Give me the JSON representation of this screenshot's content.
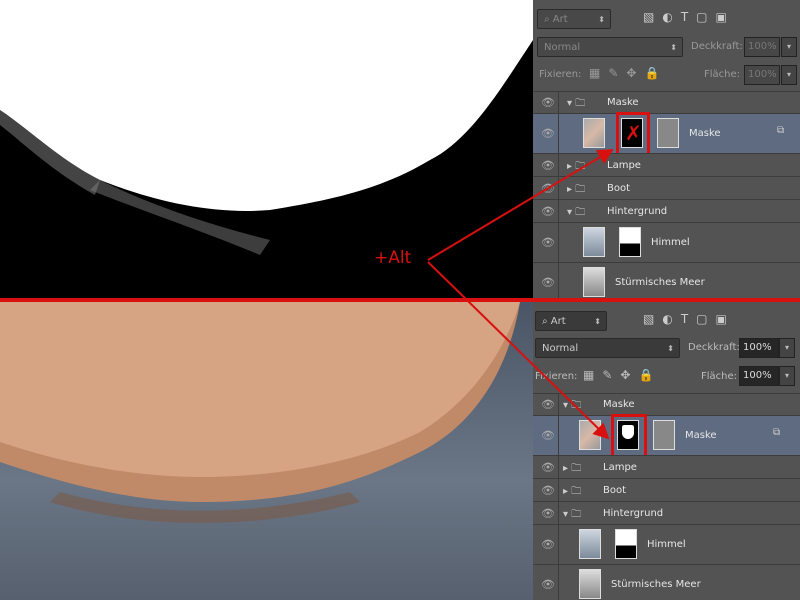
{
  "annotation": {
    "text": "+Alt",
    "color": "#d81010"
  },
  "panels": [
    {
      "filter": "Art",
      "blend": "Normal",
      "opacity_label": "Deckkraft:",
      "opacity": "100%",
      "lock_label": "Fixieren:",
      "fill_label": "Fläche:",
      "fill": "100%",
      "layers": {
        "group": "Maske",
        "mask_layer": "Maske",
        "lampe": "Lampe",
        "boot": "Boot",
        "hintergrund": "Hintergrund",
        "himmel": "Himmel",
        "meer": "Stürmisches Meer"
      }
    },
    {
      "filter": "Art",
      "blend": "Normal",
      "opacity_label": "Deckkraft:",
      "opacity": "100%",
      "lock_label": "Fixieren:",
      "fill_label": "Fläche:",
      "fill": "100%",
      "layers": {
        "group": "Maske",
        "mask_layer": "Maske",
        "lampe": "Lampe",
        "boot": "Boot",
        "hintergrund": "Hintergrund",
        "himmel": "Himmel",
        "meer": "Stürmisches Meer"
      }
    }
  ]
}
